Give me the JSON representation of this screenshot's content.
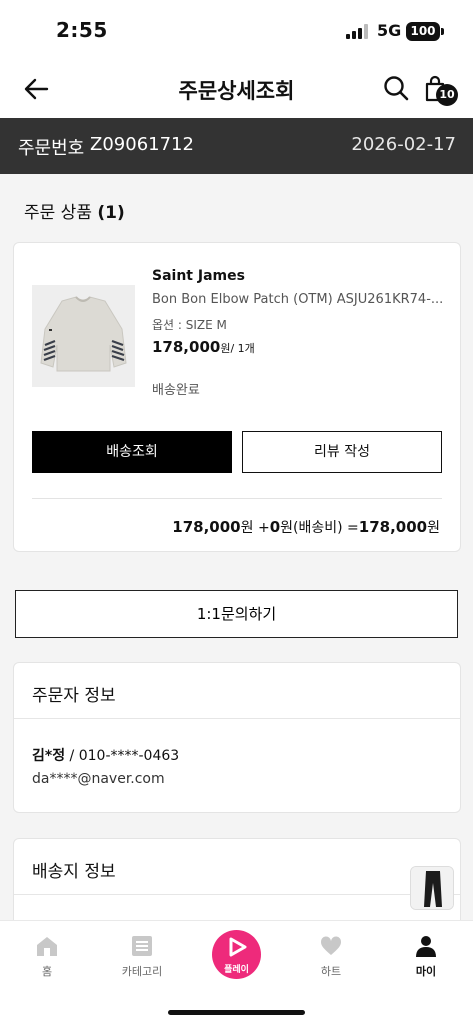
{
  "status_bar": {
    "time": "2:55",
    "network": "5G",
    "battery": "100"
  },
  "header": {
    "title": "주문상세조회",
    "cart_count": "10"
  },
  "order": {
    "label": "주문번호",
    "number": "Z09061712",
    "date": "2026-02-17"
  },
  "products_section": {
    "title": "주문 상품",
    "count": "(1)"
  },
  "product": {
    "brand": "Saint James",
    "name": "Bon Bon Elbow Patch (OTM) ASJU261KR74-...",
    "option": "옵션 : SIZE M",
    "price": "178,000",
    "price_unit": "원/ 1개",
    "status": "배송완료",
    "track_button": "배송조회",
    "review_button": "리뷰 작성"
  },
  "totals": {
    "product_amount": "178,000",
    "won": "원",
    "plus": "+",
    "shipping_amount": "0",
    "shipping_label": "원(배송비)",
    "equals": "=",
    "total_amount": "178,000"
  },
  "inquiry_button": "1:1문의하기",
  "orderer": {
    "title": "주문자 정보",
    "name": "김*정",
    "separator": " / ",
    "phone": "010-****-0463",
    "email": "da****@naver.com"
  },
  "delivery": {
    "title": "배송지 정보"
  },
  "bottom_nav": {
    "home": "홈",
    "category": "카테고리",
    "play": "플레이",
    "likes": "하트",
    "my": "마이"
  },
  "colors": {
    "play_accent": "#ee2a7b",
    "order_bar": "#333333"
  }
}
